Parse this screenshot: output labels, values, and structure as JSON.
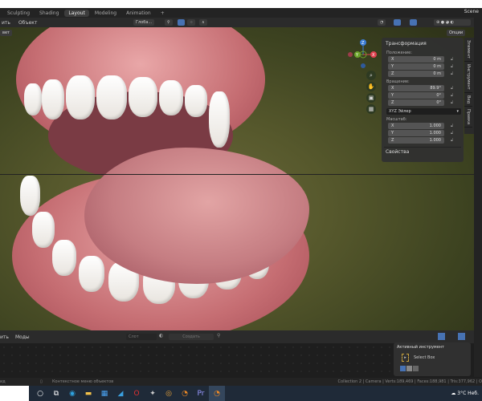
{
  "workspace_tabs": [
    "Sculpting",
    "Shading",
    "Layout",
    "Modeling",
    "Animation",
    "+"
  ],
  "active_tab": "Layout",
  "scene": "Scene",
  "header_menus": [
    "ить",
    "Объект"
  ],
  "toolbar": {
    "orientation": "Глоба...",
    "view_button": "вет",
    "options": "Опции"
  },
  "npanel": {
    "title": "Трансформация",
    "location_label": "Положение:",
    "location": [
      {
        "axis": "X",
        "value": "0 m"
      },
      {
        "axis": "Y",
        "value": "0 m"
      },
      {
        "axis": "Z",
        "value": "0 m"
      }
    ],
    "rotation_label": "Вращение:",
    "rotation": [
      {
        "axis": "X",
        "value": "89.9°"
      },
      {
        "axis": "Y",
        "value": "0°"
      },
      {
        "axis": "Z",
        "value": "0°"
      }
    ],
    "rotation_mode": "XYZ Эйлер",
    "scale_label": "Масштаб:",
    "scale": [
      {
        "axis": "X",
        "value": "1.000"
      },
      {
        "axis": "Y",
        "value": "1.000"
      },
      {
        "axis": "Z",
        "value": "1.000"
      }
    ],
    "properties": "Свойства"
  },
  "side_tabs": [
    "Элемент",
    "Инструмент",
    "Вид",
    "Правка"
  ],
  "gizmo": {
    "z": "Z",
    "y": "Y",
    "x": "X"
  },
  "timeline": {
    "menus": [
      "ить",
      "Моды"
    ],
    "slot": "Слот",
    "create": "Создать"
  },
  "active_tool": {
    "title": "Активный инструмент",
    "tool": "Select Box"
  },
  "status": {
    "left": "ид",
    "hint": "Контекстное меню объектов",
    "stats": "Collection 2 | Camera | Verts:189,469 | Faces:188,981 | Tris:377,962 | O"
  },
  "taskbar": {
    "weather": "3°C Неб."
  },
  "colors": {
    "accent": "#4772b3",
    "x_axis": "#e0404f",
    "y_axis": "#6ca32c",
    "z_axis": "#3b7dd8"
  }
}
